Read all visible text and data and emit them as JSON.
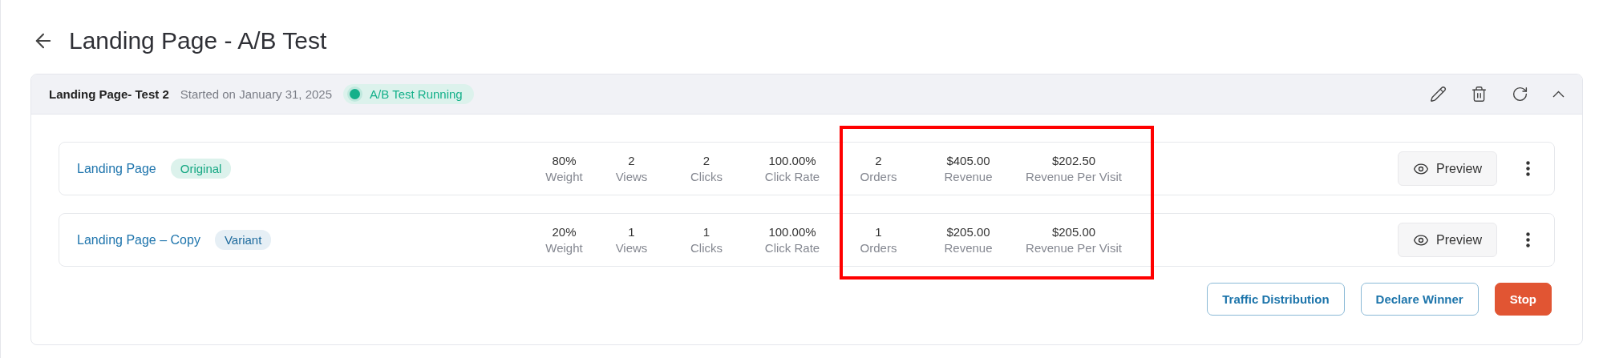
{
  "page": {
    "title": "Landing Page - A/B Test"
  },
  "test": {
    "name": "Landing Page- Test 2",
    "started": "Started on January 31, 2025",
    "status": {
      "label": "A/B Test Running",
      "color": "#14b08a"
    },
    "expanded": true
  },
  "variants": [
    {
      "name": "Landing Page",
      "badge": {
        "label": "Original",
        "kind": "original"
      },
      "stats": [
        {
          "value": "80%",
          "label": "Weight"
        },
        {
          "value": "2",
          "label": "Views"
        },
        {
          "value": "2",
          "label": "Clicks"
        },
        {
          "value": "100.00%",
          "label": "Click Rate"
        },
        {
          "value": "2",
          "label": "Orders"
        },
        {
          "value": "$405.00",
          "label": "Revenue"
        },
        {
          "value": "$202.50",
          "label": "Revenue Per Visit"
        }
      ],
      "preview": "Preview"
    },
    {
      "name": "Landing Page – Copy",
      "badge": {
        "label": "Variant",
        "kind": "variant"
      },
      "stats": [
        {
          "value": "20%",
          "label": "Weight"
        },
        {
          "value": "1",
          "label": "Views"
        },
        {
          "value": "1",
          "label": "Clicks"
        },
        {
          "value": "100.00%",
          "label": "Click Rate"
        },
        {
          "value": "1",
          "label": "Orders"
        },
        {
          "value": "$205.00",
          "label": "Revenue"
        },
        {
          "value": "$205.00",
          "label": "Revenue Per Visit"
        }
      ],
      "preview": "Preview"
    }
  ],
  "actions": [
    {
      "label": "Traffic Distribution",
      "kind": "outline"
    },
    {
      "label": "Declare Winner",
      "kind": "outline"
    },
    {
      "label": "Stop",
      "kind": "danger"
    }
  ],
  "annotation": {
    "kind": "highlight-box"
  }
}
